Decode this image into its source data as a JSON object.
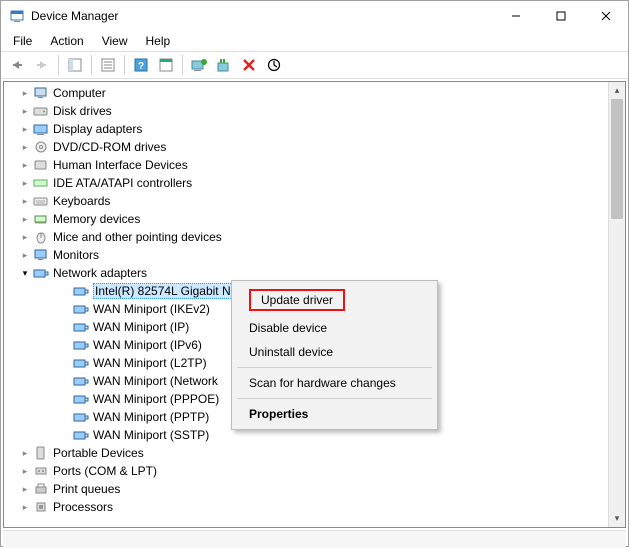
{
  "window": {
    "title": "Device Manager"
  },
  "menu": {
    "file": "File",
    "action": "Action",
    "view": "View",
    "help": "Help"
  },
  "tree": {
    "computer": "Computer",
    "disk_drives": "Disk drives",
    "display_adapters": "Display adapters",
    "dvd": "DVD/CD-ROM drives",
    "hid": "Human Interface Devices",
    "ide": "IDE ATA/ATAPI controllers",
    "keyboards": "Keyboards",
    "memory_devices": "Memory devices",
    "mice": "Mice and other pointing devices",
    "monitors": "Monitors",
    "network_adapters": "Network adapters",
    "na_items": {
      "intel": "Intel(R) 82574L Gigabit N",
      "ikev2": "WAN Miniport (IKEv2)",
      "ip": "WAN Miniport (IP)",
      "ipv6": "WAN Miniport (IPv6)",
      "l2tp": "WAN Miniport (L2TP)",
      "netmon": "WAN Miniport (Network",
      "pppoe": "WAN Miniport (PPPOE)",
      "pptp": "WAN Miniport (PPTP)",
      "sstp": "WAN Miniport (SSTP)"
    },
    "portable_devices": "Portable Devices",
    "ports": "Ports (COM & LPT)",
    "print_queues": "Print queues",
    "processors": "Processors"
  },
  "context_menu": {
    "update_driver": "Update driver",
    "disable_device": "Disable device",
    "uninstall_device": "Uninstall device",
    "scan": "Scan for hardware changes",
    "properties": "Properties"
  }
}
